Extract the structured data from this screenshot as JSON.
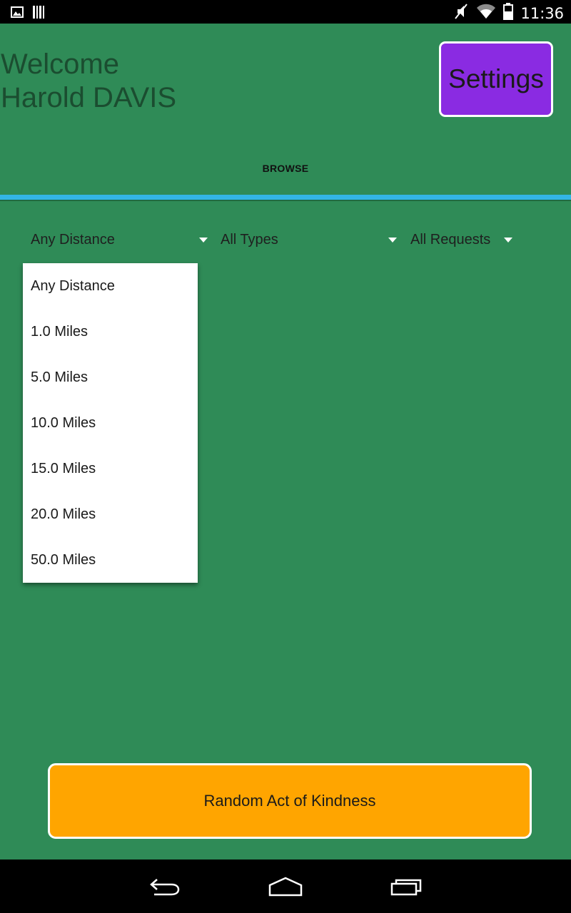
{
  "status_bar": {
    "time": "11:36",
    "icons": [
      "image-icon",
      "barcode-icon",
      "mute-icon",
      "wifi-icon",
      "battery-icon"
    ]
  },
  "header": {
    "welcome_line1": "Welcome",
    "welcome_line2": "Harold DAVIS",
    "settings_label": "Settings"
  },
  "tabs": {
    "browse_label": "BROWSE"
  },
  "filters": {
    "distance_selected": "Any Distance",
    "type_selected": "All Types",
    "request_selected": "All Requests"
  },
  "distance_dropdown": {
    "options": [
      "Any Distance",
      "1.0 Miles",
      "5.0 Miles",
      "10.0 Miles",
      "15.0 Miles",
      "20.0 Miles",
      "50.0 Miles"
    ]
  },
  "actions": {
    "random_act_label": "Random Act of Kindness"
  },
  "nav_bar": {
    "icons": [
      "back-icon",
      "home-icon",
      "recent-apps-icon"
    ]
  },
  "colors": {
    "background": "#2f8b57",
    "settings_button": "#8a2be2",
    "action_button": "#ffa500",
    "tab_indicator": "#33b5e5"
  }
}
